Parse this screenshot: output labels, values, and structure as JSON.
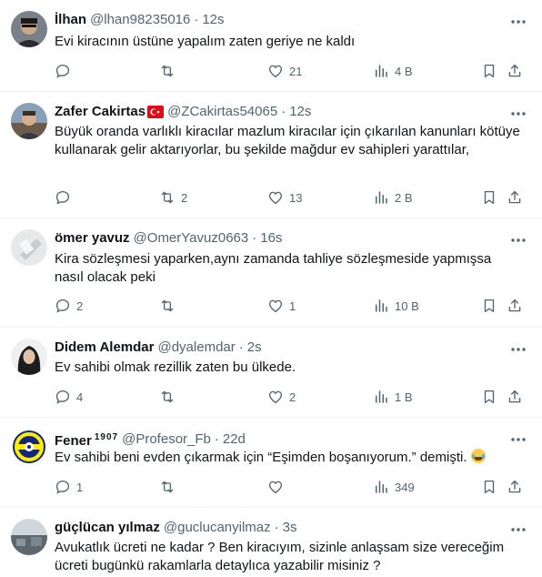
{
  "tweets": [
    {
      "name": "İlhan",
      "handle": "@lhan98235016",
      "sep": "·",
      "time": "12s",
      "text": "Evi kiracının üstüne yapalım zaten geriye ne kaldı",
      "replies": "",
      "retweets": "",
      "likes": "21",
      "views": "4 B"
    },
    {
      "name": "Zafer Cakirtas",
      "handle": "@ZCakirtas54065",
      "sep": "·",
      "time": "12s",
      "text": "Büyük oranda varlıklı kiracılar mazlum kiracılar için çıkarılan kanunları kötüye kullanarak gelir aktarıyorlar, bu şekilde mağdur ev sahipleri yarattılar,",
      "replies": "",
      "retweets": "2",
      "likes": "13",
      "views": "2 B"
    },
    {
      "name": "ömer yavuz",
      "handle": "@OmerYavuz0663",
      "sep": "·",
      "time": "16s",
      "text": "Kira sözleşmesi yaparken,aynı zamanda tahliye sözleşmeside yapmışsa nasıl olacak peki",
      "replies": "2",
      "retweets": "",
      "likes": "1",
      "views": "10 B"
    },
    {
      "name": "Didem Alemdar",
      "handle": "@dyalemdar",
      "sep": "·",
      "time": "2s",
      "text": "Ev sahibi olmak rezillik zaten bu ülkede.",
      "replies": "4",
      "retweets": "",
      "likes": "2",
      "views": "1 B"
    },
    {
      "name": "Fener",
      "name_sup": "1907",
      "handle": "@Profesor_Fb",
      "sep": "·",
      "time": "22d",
      "text": "Ev sahibi beni evden çıkarmak için “Eşimden boşanıyorum.” demişti.",
      "replies": "1",
      "retweets": "",
      "likes": "",
      "views": "349"
    },
    {
      "name": "güçlücan yılmaz",
      "handle": "@guclucanyilmaz",
      "sep": "·",
      "time": "3s",
      "text": "Avukatlık ücreti ne kadar ? Ben kiracıyım, sizinle anlaşsam size vereceğim ücreti bugünkü rakamlarla detaylıca yazabilir misiniz ?"
    }
  ],
  "icons": {
    "more": "more-icon",
    "reply": "reply-icon",
    "retweet": "retweet-icon",
    "like": "like-icon",
    "views": "views-icon",
    "bookmark": "bookmark-icon",
    "share": "share-icon",
    "flag": "turkey-flag-icon",
    "emoji": "tears-of-joy-emoji"
  },
  "colors": {
    "text": "#0f1419",
    "secondary": "#536471",
    "divider": "#eff3f4"
  }
}
